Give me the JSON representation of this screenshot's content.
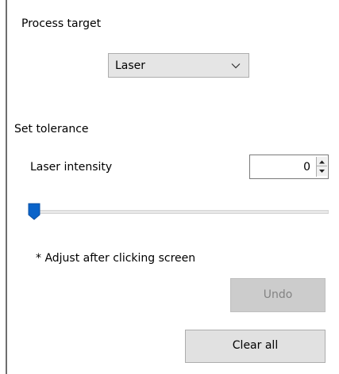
{
  "process_target": {
    "label": "Process target",
    "selected": "Laser",
    "chevron_icon": "chevron-down-icon"
  },
  "tolerance": {
    "label": "Set tolerance",
    "intensity_label": "Laser intensity",
    "intensity_value": "0",
    "slider_value": 0
  },
  "note": "* Adjust after clicking screen",
  "buttons": {
    "undo": "Undo",
    "clear_all": "Clear all"
  },
  "colors": {
    "slider_thumb": "#0a63c9",
    "disabled_button": "#cccccc",
    "button_face": "#e1e1e1"
  }
}
